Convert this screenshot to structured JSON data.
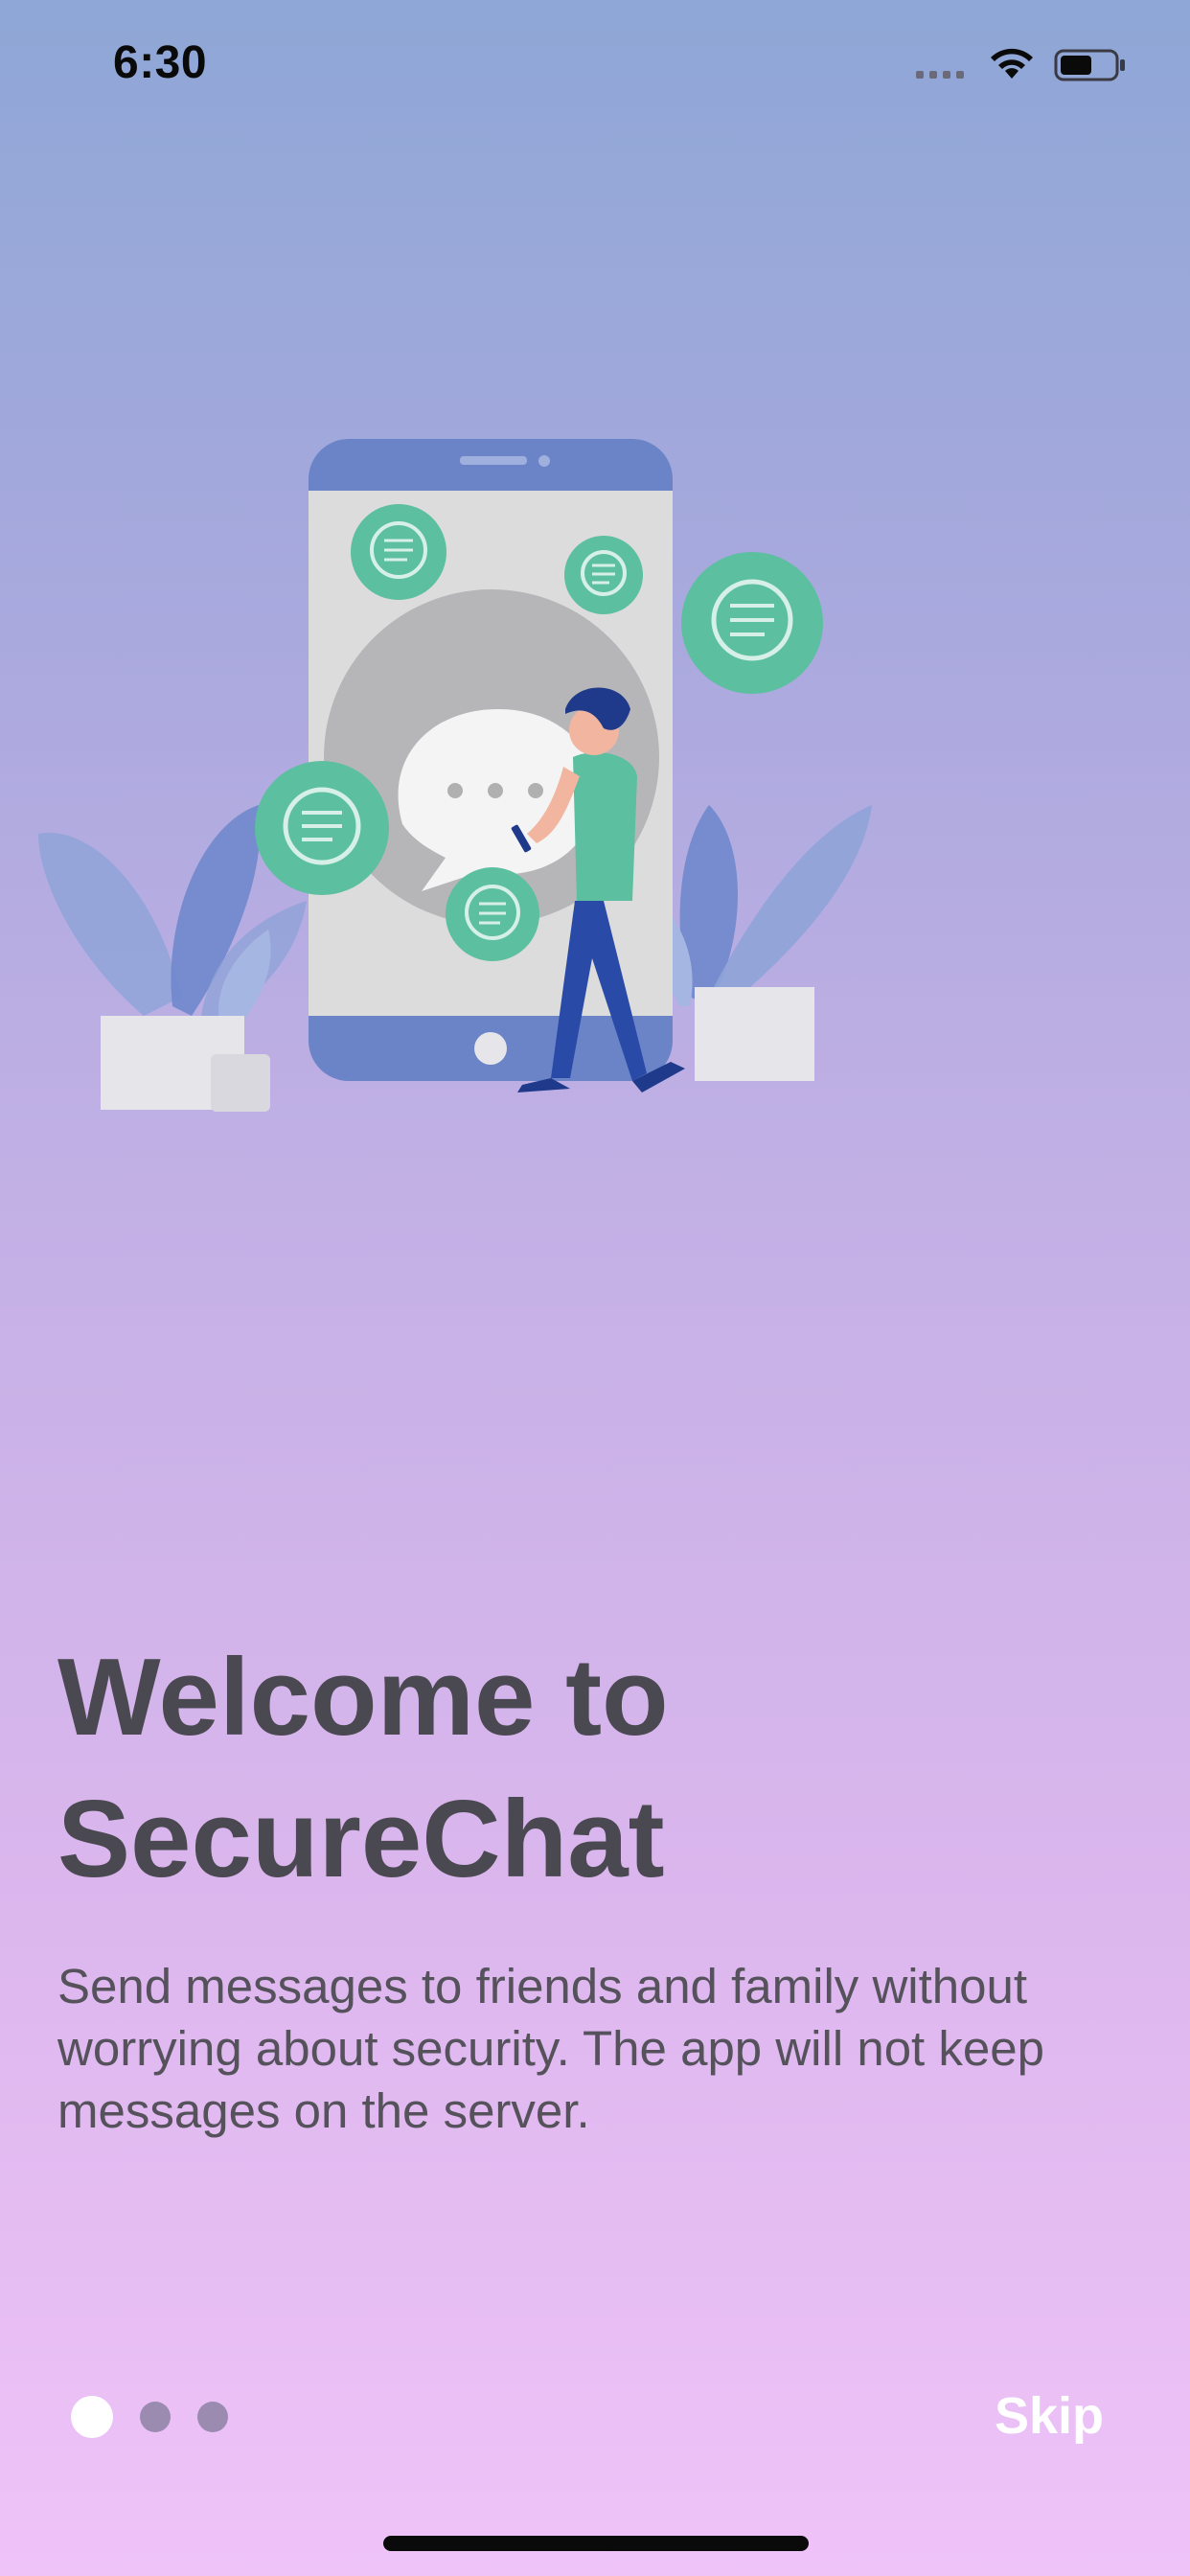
{
  "status_bar": {
    "time": "6:30",
    "icons": [
      "cellular-signal-icon",
      "wifi-icon",
      "battery-icon"
    ]
  },
  "illustration": {
    "subject": "person-with-phone-chat-illustration",
    "colors": {
      "phone": "#6b84c8",
      "screen": "#dcdcdc",
      "chat_circle": "#5cbf9f",
      "person_pants": "#2a4aa8",
      "person_shirt": "#5cbf9f"
    }
  },
  "onboarding": {
    "title_line_1": "Welcome to",
    "title_line_2": "SecureChat",
    "description": "Send messages to friends and family without worrying about security. The app will not keep messages on the server."
  },
  "pager": {
    "current_page": 1,
    "total_pages": 3
  },
  "skip_label": "Skip",
  "colors": {
    "gradient_top": "#8ea7d6",
    "gradient_bottom": "#efc3f8",
    "title": "#4a4850",
    "body_text": "#55525c",
    "dot_active": "#ffffff",
    "dot_inactive": "#9b8bb0"
  }
}
